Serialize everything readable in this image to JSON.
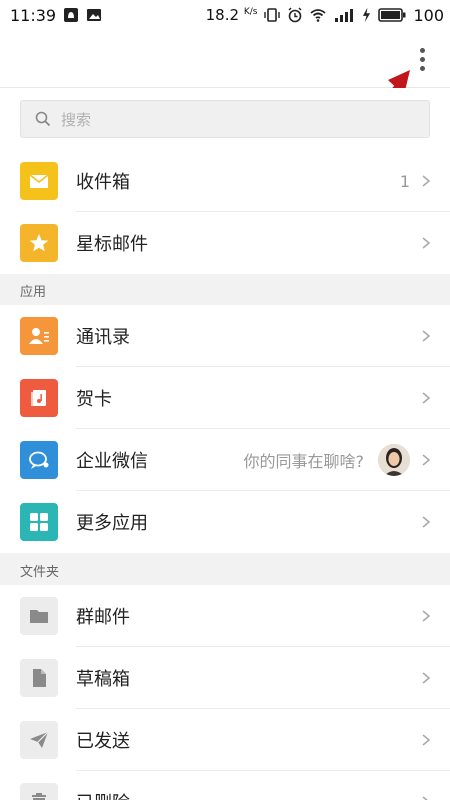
{
  "status_bar": {
    "time": "11:39",
    "speed": "18.2",
    "speed_unit": "K/s",
    "battery": "100"
  },
  "search": {
    "placeholder": "搜索"
  },
  "mailboxes": [
    {
      "label": "收件箱",
      "badge": "1",
      "icon": "envelope-icon",
      "color": "#f5c21b"
    },
    {
      "label": "星标邮件",
      "icon": "star-icon",
      "color": "#f5b52a"
    }
  ],
  "apps_section": {
    "title": "应用",
    "items": [
      {
        "label": "通讯录",
        "icon": "contacts-icon",
        "color": "#f5963a"
      },
      {
        "label": "贺卡",
        "icon": "card-icon",
        "color": "#ee5b3e"
      },
      {
        "label": "企业微信",
        "hint": "你的同事在聊啥?",
        "icon": "chat-icon",
        "color": "#2f8fd8"
      },
      {
        "label": "更多应用",
        "icon": "grid-icon",
        "color": "#2bb5b5"
      }
    ]
  },
  "folders_section": {
    "title": "文件夹",
    "items": [
      {
        "label": "群邮件",
        "icon": "folder-icon",
        "color": "#ececec"
      },
      {
        "label": "草稿箱",
        "icon": "document-icon",
        "color": "#ececec"
      },
      {
        "label": "已发送",
        "icon": "paper-plane-icon",
        "color": "#ececec"
      },
      {
        "label": "已删除",
        "icon": "trash-icon",
        "color": "#ececec"
      }
    ]
  }
}
